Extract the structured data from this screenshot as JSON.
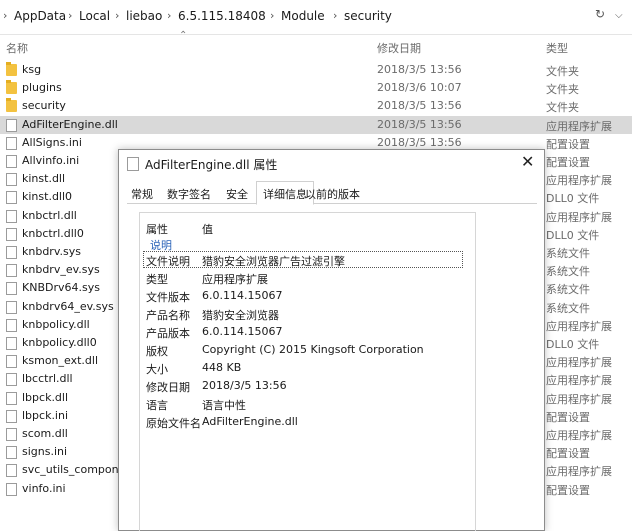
{
  "address": {
    "crumbs": [
      "AppData",
      "Local",
      "liebao",
      "6.5.115.18408",
      "Module",
      "security"
    ],
    "refresh_icon": "refresh-icon",
    "dropdown_icon": "chevron-down-icon"
  },
  "columns": {
    "name": "名称",
    "date": "修改日期",
    "type": "类型"
  },
  "files": [
    {
      "name": "ksg",
      "date": "2018/3/5 13:56",
      "type": "文件夹",
      "kind": "folder"
    },
    {
      "name": "plugins",
      "date": "2018/3/6 10:07",
      "type": "文件夹",
      "kind": "folder"
    },
    {
      "name": "security",
      "date": "2018/3/5 13:56",
      "type": "文件夹",
      "kind": "folder"
    },
    {
      "name": "AdFilterEngine.dll",
      "date": "2018/3/5 13:56",
      "type": "应用程序扩展",
      "kind": "file",
      "selected": true
    },
    {
      "name": "AllSigns.ini",
      "date": "2018/3/5 13:56",
      "type": "配置设置",
      "kind": "file"
    },
    {
      "name": "Allvinfo.ini",
      "date": "",
      "type": "配置设置",
      "kind": "file"
    },
    {
      "name": "kinst.dll",
      "date": "",
      "type": "应用程序扩展",
      "kind": "file"
    },
    {
      "name": "kinst.dll0",
      "date": "",
      "type": "DLL0 文件",
      "kind": "file"
    },
    {
      "name": "knbctrl.dll",
      "date": "",
      "type": "应用程序扩展",
      "kind": "file"
    },
    {
      "name": "knbctrl.dll0",
      "date": "",
      "type": "DLL0 文件",
      "kind": "file"
    },
    {
      "name": "knbdrv.sys",
      "date": "",
      "type": "系统文件",
      "kind": "file"
    },
    {
      "name": "knbdrv_ev.sys",
      "date": "",
      "type": "系统文件",
      "kind": "file"
    },
    {
      "name": "KNBDrv64.sys",
      "date": "",
      "type": "系统文件",
      "kind": "file"
    },
    {
      "name": "knbdrv64_ev.sys",
      "date": "",
      "type": "系统文件",
      "kind": "file"
    },
    {
      "name": "knbpolicy.dll",
      "date": "",
      "type": "应用程序扩展",
      "kind": "file"
    },
    {
      "name": "knbpolicy.dll0",
      "date": "",
      "type": "DLL0 文件",
      "kind": "file"
    },
    {
      "name": "ksmon_ext.dll",
      "date": "",
      "type": "应用程序扩展",
      "kind": "file"
    },
    {
      "name": "lbcctrl.dll",
      "date": "",
      "type": "应用程序扩展",
      "kind": "file"
    },
    {
      "name": "lbpck.dll",
      "date": "",
      "type": "应用程序扩展",
      "kind": "file"
    },
    {
      "name": "lbpck.ini",
      "date": "",
      "type": "配置设置",
      "kind": "file"
    },
    {
      "name": "scom.dll",
      "date": "",
      "type": "应用程序扩展",
      "kind": "file"
    },
    {
      "name": "signs.ini",
      "date": "",
      "type": "配置设置",
      "kind": "file"
    },
    {
      "name": "svc_utils_componen",
      "date": "",
      "type": "应用程序扩展",
      "kind": "file"
    },
    {
      "name": "vinfo.ini",
      "date": "",
      "type": "配置设置",
      "kind": "file"
    }
  ],
  "dialog": {
    "title": "AdFilterEngine.dll 属性",
    "tabs": [
      "常规",
      "数字签名",
      "安全",
      "详细信息",
      "以前的版本"
    ],
    "active_tab": "详细信息",
    "header_property": "属性",
    "header_value": "值",
    "section": "说明",
    "props": [
      {
        "key": "文件说明",
        "value": "猎豹安全浏览器广告过滤引擎"
      },
      {
        "key": "类型",
        "value": "应用程序扩展"
      },
      {
        "key": "文件版本",
        "value": "6.0.114.15067"
      },
      {
        "key": "产品名称",
        "value": "猎豹安全浏览器"
      },
      {
        "key": "产品版本",
        "value": "6.0.114.15067"
      },
      {
        "key": "版权",
        "value": "Copyright (C) 2015 Kingsoft Corporation"
      },
      {
        "key": "大小",
        "value": "448 KB"
      },
      {
        "key": "修改日期",
        "value": "2018/3/5 13:56"
      },
      {
        "key": "语言",
        "value": "语言中性"
      },
      {
        "key": "原始文件名",
        "value": "AdFilterEngine.dll"
      }
    ]
  }
}
